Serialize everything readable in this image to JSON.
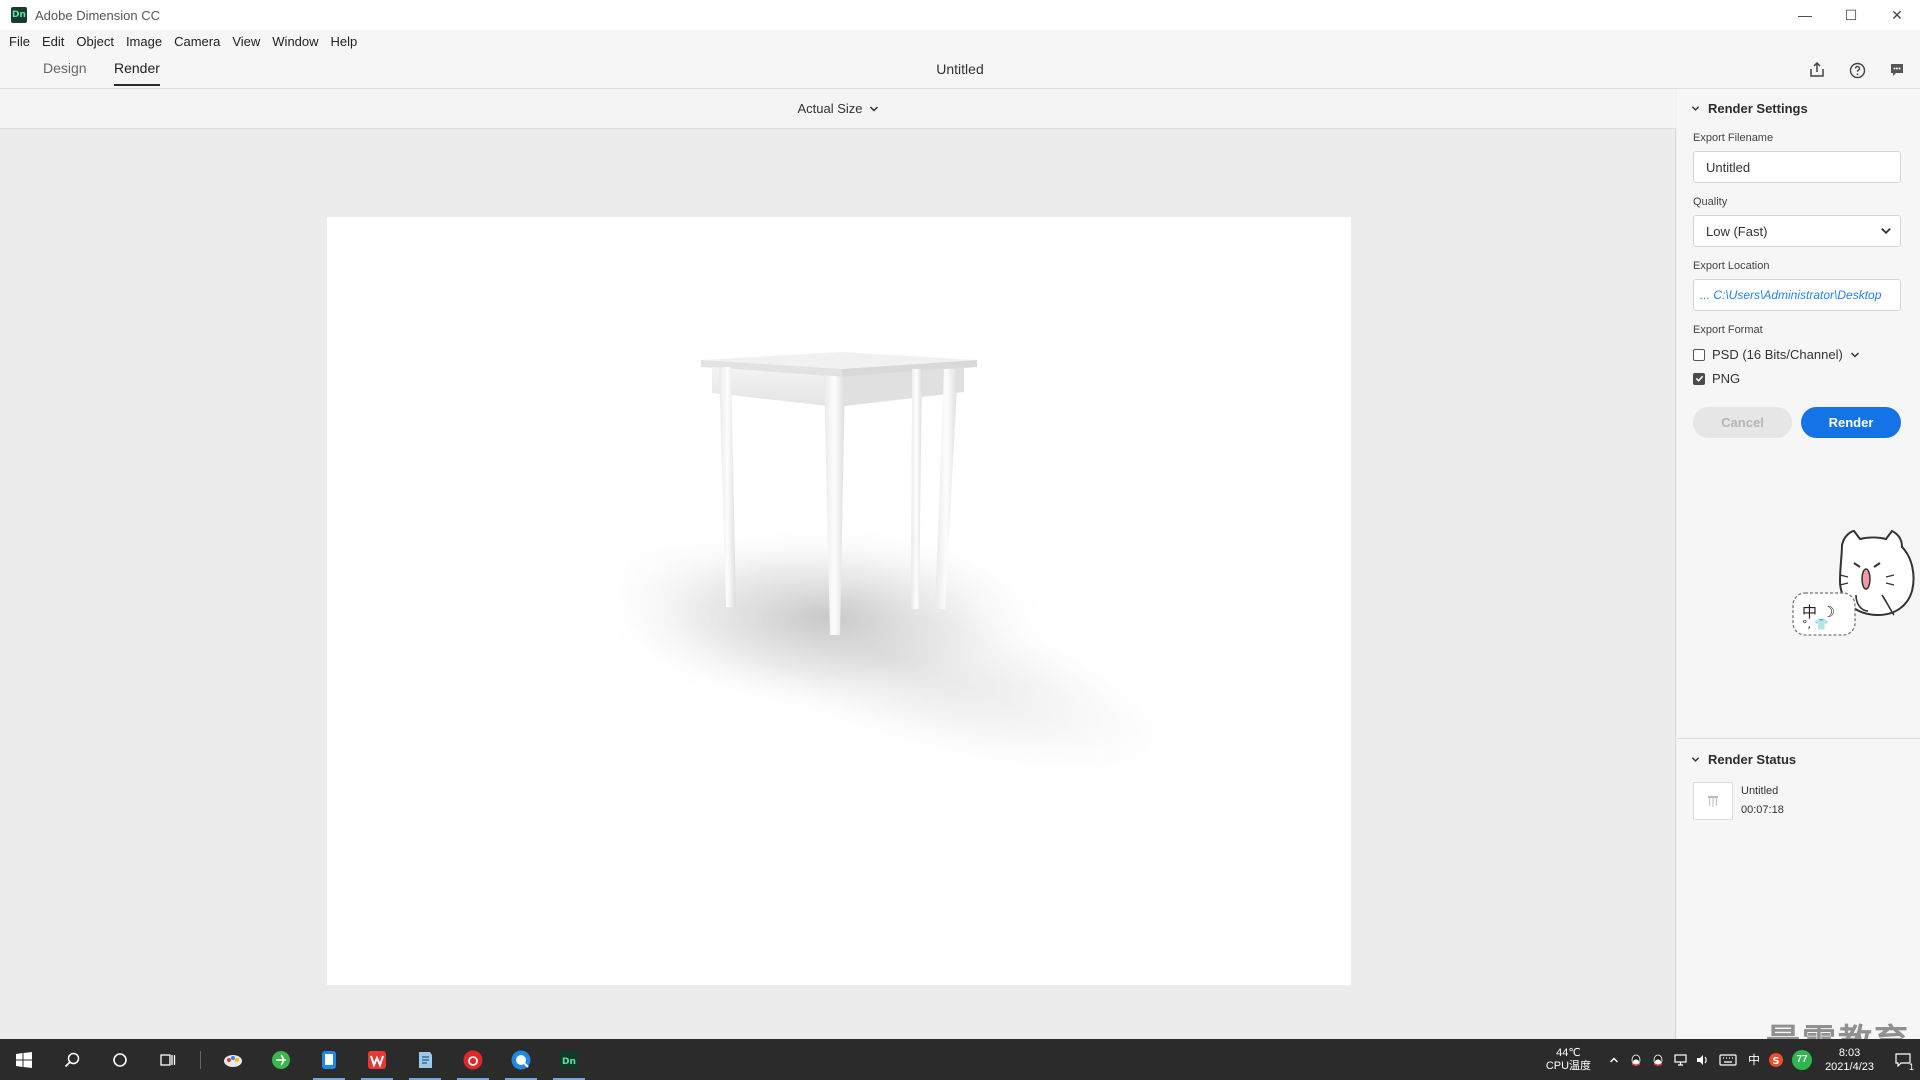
{
  "window": {
    "title": "Adobe Dimension CC",
    "logo_text": "Dn",
    "controls": {
      "minimize": "—",
      "maximize": "☐",
      "close": "✕"
    }
  },
  "menu": [
    "File",
    "Edit",
    "Object",
    "Image",
    "Camera",
    "View",
    "Window",
    "Help"
  ],
  "tabs": {
    "design": "Design",
    "render": "Render"
  },
  "document": {
    "title": "Untitled"
  },
  "canvas": {
    "zoom_label": "Actual Size"
  },
  "render_settings": {
    "header": "Render Settings",
    "export_filename_label": "Export Filename",
    "export_filename_value": "Untitled",
    "quality_label": "Quality",
    "quality_value": "Low (Fast)",
    "export_location_label": "Export Location",
    "export_location_value": "... C:\\Users\\Administrator\\Desktop",
    "export_format_label": "Export Format",
    "formats": [
      {
        "label": "PSD (16 Bits/Channel)",
        "checked": false
      },
      {
        "label": "PNG",
        "checked": true
      }
    ],
    "cancel_label": "Cancel",
    "render_label": "Render"
  },
  "render_status": {
    "header": "Render Status",
    "item_name": "Untitled",
    "item_time": "00:07:18"
  },
  "sticker": {
    "text": "中 ☽",
    "text2": "°, 👕"
  },
  "taskbar": {
    "temp": "44℃",
    "temp_label": "CPU温度",
    "ime": "中",
    "badge": "77",
    "time": "8:03",
    "date": "2021/4/23",
    "notification_count": "1"
  },
  "watermark": "最需教育",
  "colors": {
    "accent": "#1473e6",
    "link": "#2680eb",
    "taskbar": "#2b2b2b"
  }
}
